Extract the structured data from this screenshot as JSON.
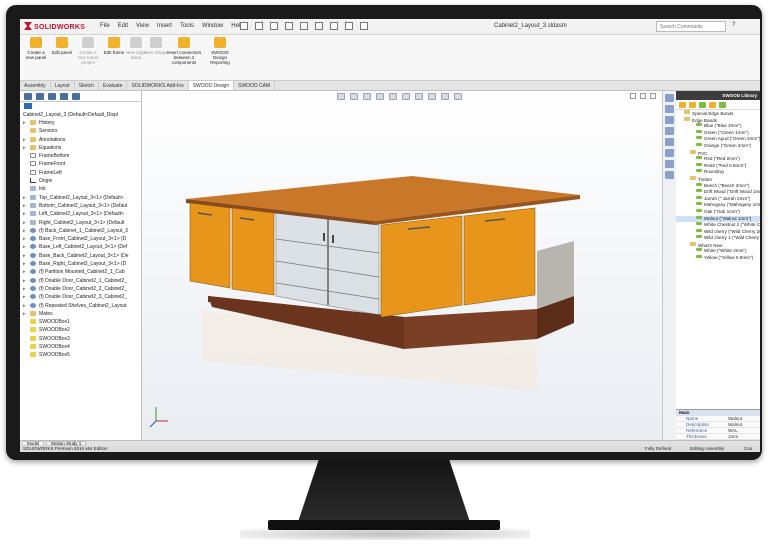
{
  "app": {
    "logo": "SOLIDWORKS",
    "document_title": "Cabinet2_Layout_3.sldasm",
    "search_placeholder": "Search Commands",
    "help": "?"
  },
  "menu": [
    "File",
    "Edit",
    "View",
    "Insert",
    "Tools",
    "Window",
    "Help"
  ],
  "ribbon_buttons": [
    {
      "label": "Create a new panel",
      "enabled": true
    },
    {
      "label": "Edit panel",
      "enabled": true
    },
    {
      "label": "Create a new frame project",
      "enabled": false
    },
    {
      "label": "Edit frame",
      "enabled": true
    },
    {
      "label": "New edge band",
      "enabled": false
    },
    {
      "label": "New Shape",
      "enabled": false
    },
    {
      "label": "Insert connectors between 2 components",
      "enabled": true
    },
    {
      "label": "SWOOD Design Reporting",
      "enabled": true
    }
  ],
  "ribbon_tabs": [
    {
      "label": "Assembly",
      "active": false
    },
    {
      "label": "Layout",
      "active": false
    },
    {
      "label": "Sketch",
      "active": false
    },
    {
      "label": "Evaluate",
      "active": false
    },
    {
      "label": "SOLIDWORKS Add-Ins",
      "active": false
    },
    {
      "label": "SWOOD Design",
      "active": true
    },
    {
      "label": "SWOOD CAM",
      "active": false
    }
  ],
  "tree": {
    "root": "Cabinet2_Layout_3 (Default<Default_Displ",
    "items": [
      {
        "label": "History",
        "kind": "folder",
        "exp": "▸"
      },
      {
        "label": "Sensors",
        "kind": "folder",
        "exp": ""
      },
      {
        "label": "Annotations",
        "kind": "folder",
        "exp": "▸"
      },
      {
        "label": "Equations",
        "kind": "folder",
        "exp": "▸"
      },
      {
        "label": "FrameBottom",
        "kind": "plane",
        "exp": ""
      },
      {
        "label": "FrameFront",
        "kind": "plane",
        "exp": ""
      },
      {
        "label": "FrameLeft",
        "kind": "plane",
        "exp": ""
      },
      {
        "label": "Origin",
        "kind": "origin",
        "exp": ""
      },
      {
        "label": "Init",
        "kind": "part",
        "exp": ""
      },
      {
        "label": "Top_Cabinet2_Layout_3<1> (Default<",
        "kind": "part",
        "exp": "▸"
      },
      {
        "label": "Bottom_Cabinet2_Layout_3<1> (Defaul",
        "kind": "part",
        "exp": "▸"
      },
      {
        "label": "Left_Cabinet2_Layout_3<1> (Default<",
        "kind": "part",
        "exp": "▸"
      },
      {
        "label": "Right_Cabinet2_Layout_3<1> (Default",
        "kind": "part",
        "exp": "▸"
      },
      {
        "label": "(f) Back_Cabinet_1_Cabinet2_Layout_3",
        "kind": "sub",
        "exp": "▸"
      },
      {
        "label": "Base_Front_Cabinet2_Layout_3<1> (D",
        "kind": "sub",
        "exp": "▸"
      },
      {
        "label": "Base_Left_Cabinet2_Layout_3<1> (Def",
        "kind": "sub",
        "exp": "▸"
      },
      {
        "label": "Base_Back_Cabinet2_Layout_3<1> (De",
        "kind": "sub",
        "exp": "▸"
      },
      {
        "label": "Base_Right_Cabinet2_Layout_3<1> (D",
        "kind": "sub",
        "exp": "▸"
      },
      {
        "label": "(f) Partition Mounted_Cabinet2_1_Cab",
        "kind": "sub",
        "exp": "▸"
      },
      {
        "label": "(f) Double Door_Cabinet2_1_Cabinet2_",
        "kind": "sub",
        "exp": "▸"
      },
      {
        "label": "(f) Double Door_Cabinet2_2_Cabinet2_",
        "kind": "sub",
        "exp": "▸"
      },
      {
        "label": "(f) Double Door_Cabinet2_3_Cabinet2_",
        "kind": "sub",
        "exp": "▸"
      },
      {
        "label": "(f) Repeated Shelves_Cabinet2_Layout",
        "kind": "sub",
        "exp": "▸"
      },
      {
        "label": "Mates",
        "kind": "folder",
        "exp": "▸"
      },
      {
        "label": "SWOODBox1",
        "kind": "box",
        "exp": ""
      },
      {
        "label": "SWOODBox2",
        "kind": "box",
        "exp": ""
      },
      {
        "label": "SWOODBox3",
        "kind": "box",
        "exp": ""
      },
      {
        "label": "SWOODBox4",
        "kind": "box",
        "exp": ""
      },
      {
        "label": "SWOODBox5",
        "kind": "box",
        "exp": ""
      }
    ]
  },
  "bottom_tabs": [
    {
      "label": "Model",
      "active": true
    },
    {
      "label": "Motion Study 1",
      "active": false
    }
  ],
  "status": {
    "edition": "SOLIDWORKS Premium 2016 x64 Edition",
    "state": "Fully Defined",
    "mode": "Editing Assembly",
    "cut": "Cus"
  },
  "library": {
    "title": "SWOOD Library",
    "rows": [
      {
        "label": "Special Edge Bands",
        "indent": 1,
        "kind": "folder",
        "selected": false
      },
      {
        "label": "Edge Bands",
        "indent": 1,
        "kind": "folder",
        "selected": false
      },
      {
        "label": "Blue (\"Blue 2mm\")",
        "indent": 3,
        "kind": "item",
        "selected": false
      },
      {
        "label": "Green (\"Green 1mm\")",
        "indent": 3,
        "kind": "item",
        "selected": false
      },
      {
        "label": "Green Apud (\"Green 2mm\")",
        "indent": 3,
        "kind": "item",
        "selected": false
      },
      {
        "label": "Orange (\"Green 2mm\")",
        "indent": 3,
        "kind": "item",
        "selected": false
      },
      {
        "label": "PVC",
        "indent": 2,
        "kind": "folder",
        "selected": false
      },
      {
        "label": "Red (\"Red 2mm\")",
        "indent": 3,
        "kind": "item",
        "selected": false
      },
      {
        "label": "Red2 (\"Red 0.8mm\")",
        "indent": 3,
        "kind": "item",
        "selected": false
      },
      {
        "label": "Rounding",
        "indent": 3,
        "kind": "item",
        "selected": false
      },
      {
        "label": "Timber",
        "indent": 2,
        "kind": "folder",
        "selected": false
      },
      {
        "label": "Beech (\"Beech 2mm\")",
        "indent": 3,
        "kind": "item",
        "selected": false
      },
      {
        "label": "Drift Wood (\"Drift Wood 1mm",
        "indent": 3,
        "kind": "item",
        "selected": false
      },
      {
        "label": "Jarrah (\" Jarrah 2mm\")",
        "indent": 3,
        "kind": "item",
        "selected": false
      },
      {
        "label": "Mahogany (\"Mahogany 1mm",
        "indent": 3,
        "kind": "item",
        "selected": false
      },
      {
        "label": "Oak (\"Oak 1mm\")",
        "indent": 3,
        "kind": "item",
        "selected": false
      },
      {
        "label": "Walnut (\"Walnut 1mm\")",
        "indent": 3,
        "kind": "item",
        "selected": true
      },
      {
        "label": "White Chestnut 2 (\"White Ch",
        "indent": 3,
        "kind": "item",
        "selected": false
      },
      {
        "label": "Wild cherry (\"Wild Cherry 2n",
        "indent": 3,
        "kind": "item",
        "selected": false
      },
      {
        "label": "Wild cherry 1 (\"Wild Cherry 1",
        "indent": 3,
        "kind": "item",
        "selected": false
      },
      {
        "label": "What's New",
        "indent": 2,
        "kind": "folder",
        "selected": false
      },
      {
        "label": "White (\"White 2mm\")",
        "indent": 3,
        "kind": "item",
        "selected": false
      },
      {
        "label": "Yellow (\"Yellow 0.8mm\")",
        "indent": 3,
        "kind": "item",
        "selected": false
      }
    ]
  },
  "properties": {
    "section": "Main",
    "rows": [
      {
        "key": "Name",
        "value": "Walnut"
      },
      {
        "key": "Description",
        "value": "Walnut"
      },
      {
        "key": "Reference",
        "value": "WAL"
      },
      {
        "key": "Thickness",
        "value": "1mm"
      }
    ]
  },
  "colors": {
    "door_orange": "#e8951c",
    "top_wood": "#c9782a",
    "plinth": "#7a3f25",
    "brand_red": "#c8102e"
  }
}
